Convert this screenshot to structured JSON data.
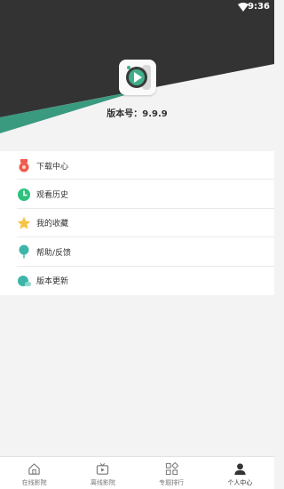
{
  "status_bar": {
    "time": "9:36"
  },
  "header": {
    "version_label": "版本号：9.9.9",
    "colors": {
      "dark": "#333333",
      "teal": "#3a9a80",
      "light": "#f3f3f3"
    }
  },
  "menu": {
    "items": [
      {
        "label": "下载中心",
        "icon": "download-badge-icon",
        "color": "#ef5b4e"
      },
      {
        "label": "观看历史",
        "icon": "clock-icon",
        "color": "#2ec27e"
      },
      {
        "label": "我的收藏",
        "icon": "star-icon",
        "color": "#f6c344"
      },
      {
        "label": "帮助/反馈",
        "icon": "balloon-icon",
        "color": "#3cb6a8"
      },
      {
        "label": "版本更新",
        "icon": "chat-bubble-icon",
        "color": "#3cb6a8"
      }
    ]
  },
  "bottom_nav": {
    "tabs": [
      {
        "label": "在线影院",
        "icon": "home-icon"
      },
      {
        "label": "离线影院",
        "icon": "tv-icon"
      },
      {
        "label": "专题排行",
        "icon": "grid-icon"
      },
      {
        "label": "个人中心",
        "icon": "person-icon"
      }
    ],
    "active_index": 3
  }
}
